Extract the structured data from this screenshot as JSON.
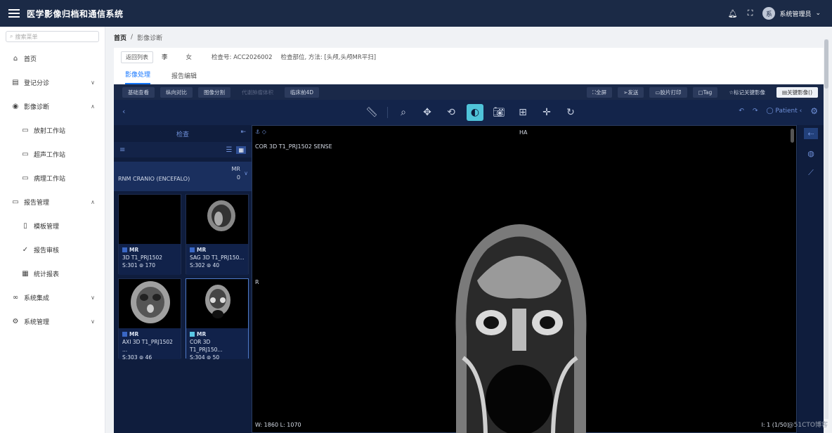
{
  "app": {
    "title": "医学影像归档和通信系统",
    "user": "系统管理员",
    "avatar": "系"
  },
  "sidebar": {
    "search_placeholder": "搜索菜单",
    "items": [
      {
        "label": "首页"
      },
      {
        "label": "登记分诊"
      },
      {
        "label": "影像诊断"
      },
      {
        "label": "放射工作站"
      },
      {
        "label": "超声工作站"
      },
      {
        "label": "病理工作站"
      },
      {
        "label": "报告管理"
      },
      {
        "label": "模板管理"
      },
      {
        "label": "报告审核"
      },
      {
        "label": "统计报表"
      },
      {
        "label": "系统集成"
      },
      {
        "label": "系统管理"
      }
    ]
  },
  "breadcrumb": {
    "home": "首页",
    "sep": "/",
    "current": "影像诊断"
  },
  "patient": {
    "back": "返回列表",
    "name": "李",
    "gender": "女",
    "exam_no": "检查号: ACC2026002",
    "exam_part": "检查部位, 方法: [头颅,头颅MR平扫]"
  },
  "tabs": {
    "t1": "影像处理",
    "t2": "报告编辑"
  },
  "toolbar1": {
    "b1": "基础查看",
    "b2": "纵向对比",
    "b3": "图像分割",
    "b4": "代谢肿瘤体积",
    "b5": "临床前4D",
    "r1": "⛶全屏",
    "r2": "发送",
    "r3": "胶片打印",
    "r4": "Tag",
    "r5": "☆标记关键影像",
    "r6": "关键影像()"
  },
  "toolbar2": {
    "patient": "Patient"
  },
  "panel": {
    "title": "检查",
    "study_desc": "RNM CRANIO (ENCEFALO)",
    "study_mod": "MR",
    "study_count": "0",
    "series": [
      {
        "mod": "MR",
        "name": "3D T1_PRJ1502",
        "meta": "S:301  ⊚ 170"
      },
      {
        "mod": "MR",
        "name": "SAG 3D T1_PRJ150...",
        "meta": "S:302  ⊚ 40"
      },
      {
        "mod": "MR",
        "name": "AXI 3D T1_PRJ1502 ...",
        "meta": "S:303  ⊚ 46"
      },
      {
        "mod": "MR",
        "name": "COR 3D T1_PRJ150...",
        "meta": "S:304  ⊚ 50"
      }
    ]
  },
  "viewport": {
    "top_center": "HA",
    "series_desc": "COR 3D T1_PRJ1502 SENSE",
    "left_mid": "R",
    "wl": "W: 1860  L: 1070",
    "frame": "I: 1 (1/50)"
  },
  "watermark": "@51CTO博客"
}
